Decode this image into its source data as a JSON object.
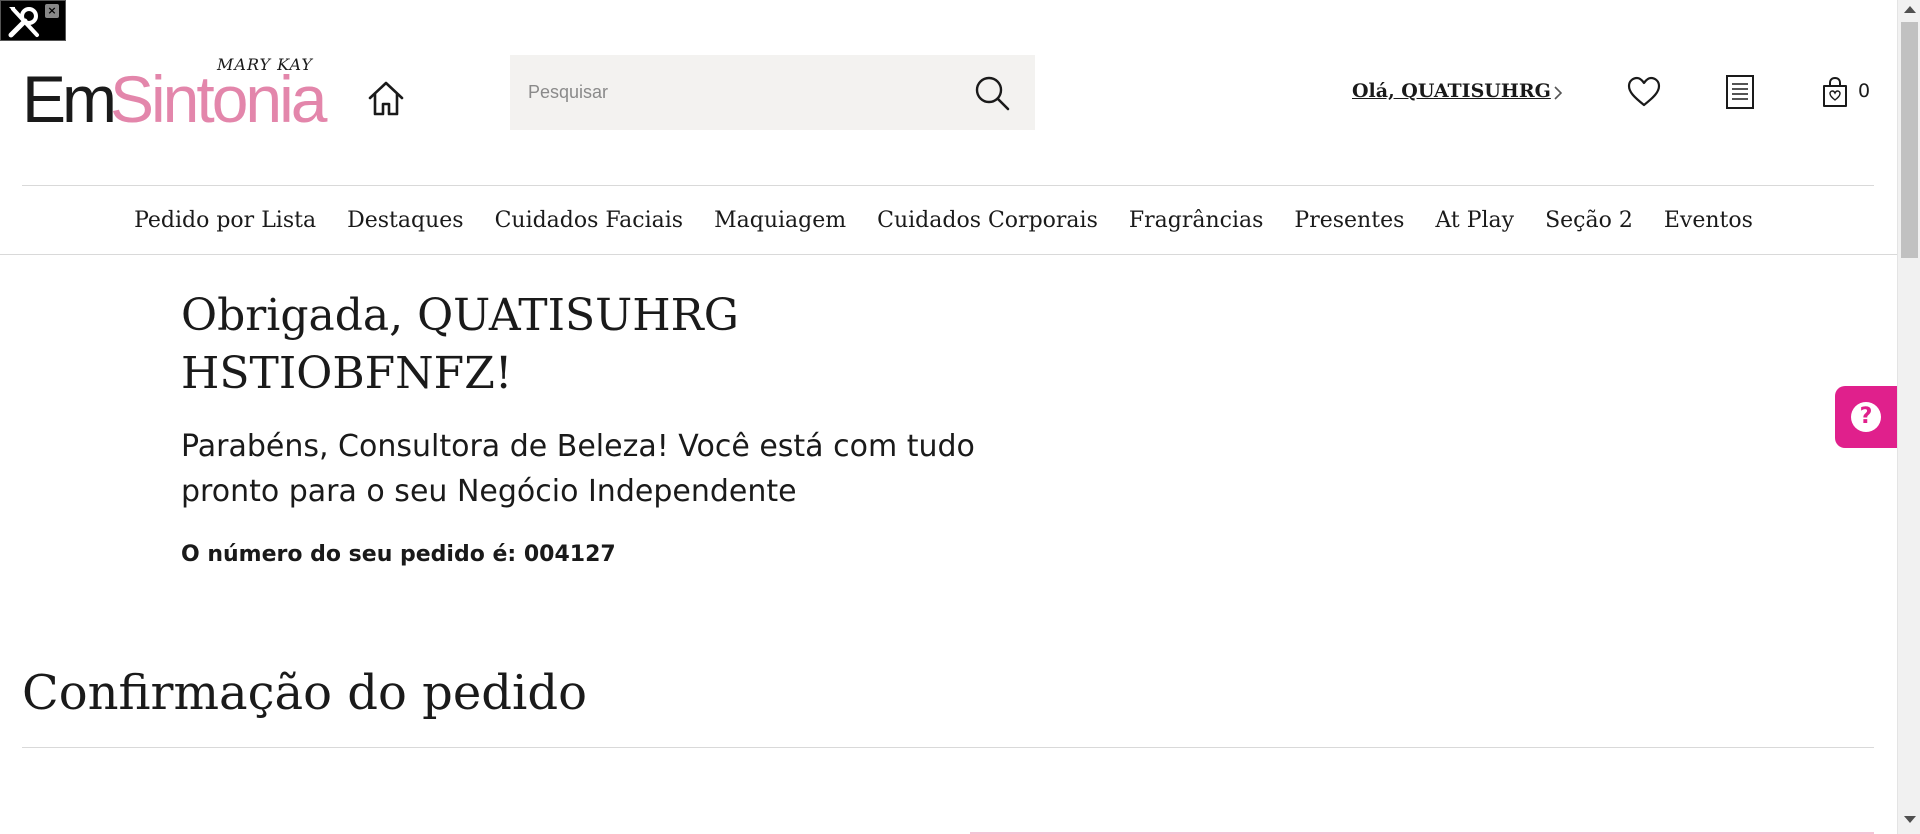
{
  "brand": {
    "top": "MARY KAY",
    "em": "Em",
    "sintonia": "Sintonia",
    "pink": "#e386ab"
  },
  "header": {
    "search_placeholder": "Pesquisar",
    "greeting": "Olá, QUATISUHRG",
    "cart_count": "0",
    "icons": [
      "home-icon",
      "search-icon",
      "chevron-right-icon",
      "heart-icon",
      "list-icon",
      "bag-icon"
    ]
  },
  "nav": {
    "items": [
      {
        "label": "Pedido por Lista"
      },
      {
        "label": "Destaques"
      },
      {
        "label": "Cuidados Faciais"
      },
      {
        "label": "Maquiagem"
      },
      {
        "label": "Cuidados Corporais"
      },
      {
        "label": "Fragrâncias"
      },
      {
        "label": "Presentes"
      },
      {
        "label": "At Play"
      },
      {
        "label": "Seção 2"
      },
      {
        "label": "Eventos"
      }
    ]
  },
  "main": {
    "thanks_line1": "Obrigada, QUATISUHRG",
    "thanks_line2": "HSTIOBFNFZ!",
    "congrats": "Parabéns, Consultora de Beleza! Você está com tudo pronto para o seu Negócio Independente",
    "order_number": "O número do seu pedido é: 004127",
    "confirmation_title": "Confirmação do pedido"
  },
  "help": {
    "symbol": "?",
    "color": "#e0208c"
  },
  "devtools": {
    "close": "×"
  }
}
